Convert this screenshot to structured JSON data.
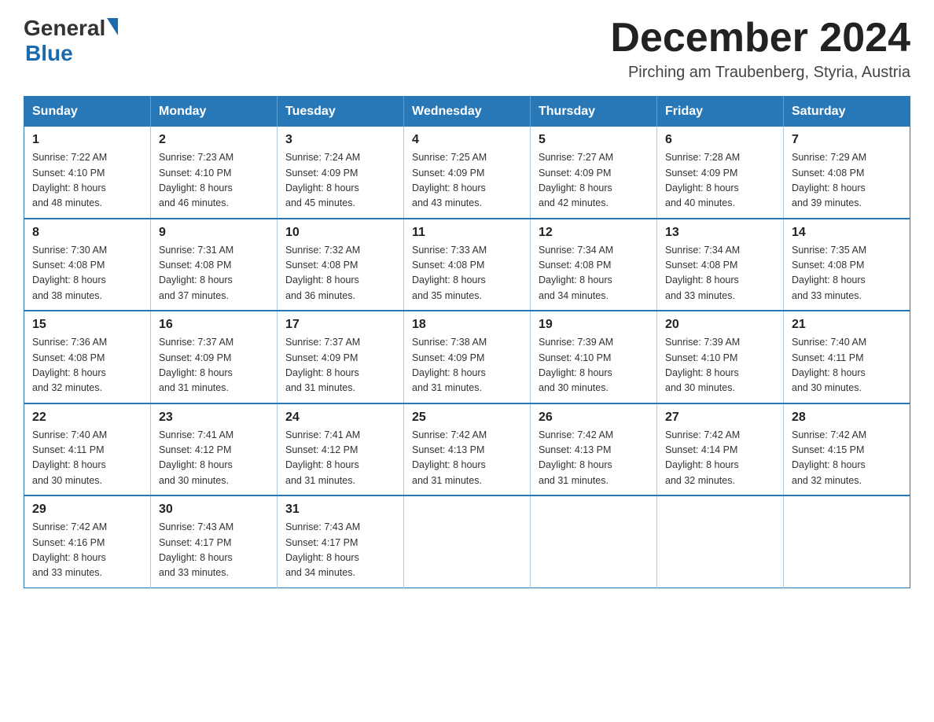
{
  "logo": {
    "general": "General",
    "blue": "Blue"
  },
  "title": "December 2024",
  "location": "Pirching am Traubenberg, Styria, Austria",
  "weekdays": [
    "Sunday",
    "Monday",
    "Tuesday",
    "Wednesday",
    "Thursday",
    "Friday",
    "Saturday"
  ],
  "weeks": [
    [
      {
        "day": "1",
        "sunrise": "7:22 AM",
        "sunset": "4:10 PM",
        "daylight": "8 hours and 48 minutes."
      },
      {
        "day": "2",
        "sunrise": "7:23 AM",
        "sunset": "4:10 PM",
        "daylight": "8 hours and 46 minutes."
      },
      {
        "day": "3",
        "sunrise": "7:24 AM",
        "sunset": "4:09 PM",
        "daylight": "8 hours and 45 minutes."
      },
      {
        "day": "4",
        "sunrise": "7:25 AM",
        "sunset": "4:09 PM",
        "daylight": "8 hours and 43 minutes."
      },
      {
        "day": "5",
        "sunrise": "7:27 AM",
        "sunset": "4:09 PM",
        "daylight": "8 hours and 42 minutes."
      },
      {
        "day": "6",
        "sunrise": "7:28 AM",
        "sunset": "4:09 PM",
        "daylight": "8 hours and 40 minutes."
      },
      {
        "day": "7",
        "sunrise": "7:29 AM",
        "sunset": "4:08 PM",
        "daylight": "8 hours and 39 minutes."
      }
    ],
    [
      {
        "day": "8",
        "sunrise": "7:30 AM",
        "sunset": "4:08 PM",
        "daylight": "8 hours and 38 minutes."
      },
      {
        "day": "9",
        "sunrise": "7:31 AM",
        "sunset": "4:08 PM",
        "daylight": "8 hours and 37 minutes."
      },
      {
        "day": "10",
        "sunrise": "7:32 AM",
        "sunset": "4:08 PM",
        "daylight": "8 hours and 36 minutes."
      },
      {
        "day": "11",
        "sunrise": "7:33 AM",
        "sunset": "4:08 PM",
        "daylight": "8 hours and 35 minutes."
      },
      {
        "day": "12",
        "sunrise": "7:34 AM",
        "sunset": "4:08 PM",
        "daylight": "8 hours and 34 minutes."
      },
      {
        "day": "13",
        "sunrise": "7:34 AM",
        "sunset": "4:08 PM",
        "daylight": "8 hours and 33 minutes."
      },
      {
        "day": "14",
        "sunrise": "7:35 AM",
        "sunset": "4:08 PM",
        "daylight": "8 hours and 33 minutes."
      }
    ],
    [
      {
        "day": "15",
        "sunrise": "7:36 AM",
        "sunset": "4:08 PM",
        "daylight": "8 hours and 32 minutes."
      },
      {
        "day": "16",
        "sunrise": "7:37 AM",
        "sunset": "4:09 PM",
        "daylight": "8 hours and 31 minutes."
      },
      {
        "day": "17",
        "sunrise": "7:37 AM",
        "sunset": "4:09 PM",
        "daylight": "8 hours and 31 minutes."
      },
      {
        "day": "18",
        "sunrise": "7:38 AM",
        "sunset": "4:09 PM",
        "daylight": "8 hours and 31 minutes."
      },
      {
        "day": "19",
        "sunrise": "7:39 AM",
        "sunset": "4:10 PM",
        "daylight": "8 hours and 30 minutes."
      },
      {
        "day": "20",
        "sunrise": "7:39 AM",
        "sunset": "4:10 PM",
        "daylight": "8 hours and 30 minutes."
      },
      {
        "day": "21",
        "sunrise": "7:40 AM",
        "sunset": "4:11 PM",
        "daylight": "8 hours and 30 minutes."
      }
    ],
    [
      {
        "day": "22",
        "sunrise": "7:40 AM",
        "sunset": "4:11 PM",
        "daylight": "8 hours and 30 minutes."
      },
      {
        "day": "23",
        "sunrise": "7:41 AM",
        "sunset": "4:12 PM",
        "daylight": "8 hours and 30 minutes."
      },
      {
        "day": "24",
        "sunrise": "7:41 AM",
        "sunset": "4:12 PM",
        "daylight": "8 hours and 31 minutes."
      },
      {
        "day": "25",
        "sunrise": "7:42 AM",
        "sunset": "4:13 PM",
        "daylight": "8 hours and 31 minutes."
      },
      {
        "day": "26",
        "sunrise": "7:42 AM",
        "sunset": "4:13 PM",
        "daylight": "8 hours and 31 minutes."
      },
      {
        "day": "27",
        "sunrise": "7:42 AM",
        "sunset": "4:14 PM",
        "daylight": "8 hours and 32 minutes."
      },
      {
        "day": "28",
        "sunrise": "7:42 AM",
        "sunset": "4:15 PM",
        "daylight": "8 hours and 32 minutes."
      }
    ],
    [
      {
        "day": "29",
        "sunrise": "7:42 AM",
        "sunset": "4:16 PM",
        "daylight": "8 hours and 33 minutes."
      },
      {
        "day": "30",
        "sunrise": "7:43 AM",
        "sunset": "4:17 PM",
        "daylight": "8 hours and 33 minutes."
      },
      {
        "day": "31",
        "sunrise": "7:43 AM",
        "sunset": "4:17 PM",
        "daylight": "8 hours and 34 minutes."
      },
      null,
      null,
      null,
      null
    ]
  ],
  "labels": {
    "sunrise": "Sunrise:",
    "sunset": "Sunset:",
    "daylight": "Daylight:"
  }
}
